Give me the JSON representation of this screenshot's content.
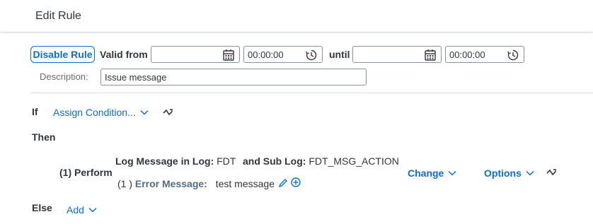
{
  "header": {
    "title": "Edit Rule"
  },
  "rule": {
    "disable_button": "Disable Rule",
    "valid_from_label": "Valid from",
    "valid_from_date": "",
    "valid_from_time": "00:00:00",
    "until_label": "until",
    "until_date": "",
    "until_time": "00:00:00",
    "description_label": "Description:",
    "description_value": "Issue message"
  },
  "if_section": {
    "label": "If",
    "assign_condition": "Assign Condition..."
  },
  "then_section": {
    "label": "Then",
    "perform_label": "(1) Perform",
    "log_message_label": "Log Message in Log:",
    "log_value": "FDT",
    "sub_log_label": "and Sub Log:",
    "sub_log_value": "FDT_MSG_ACTION",
    "error_index": "(1 )",
    "error_label": "Error Message:",
    "error_value": "test message",
    "change_link": "Change",
    "options_link": "Options"
  },
  "else_section": {
    "label": "Else",
    "add_link": "Add"
  }
}
